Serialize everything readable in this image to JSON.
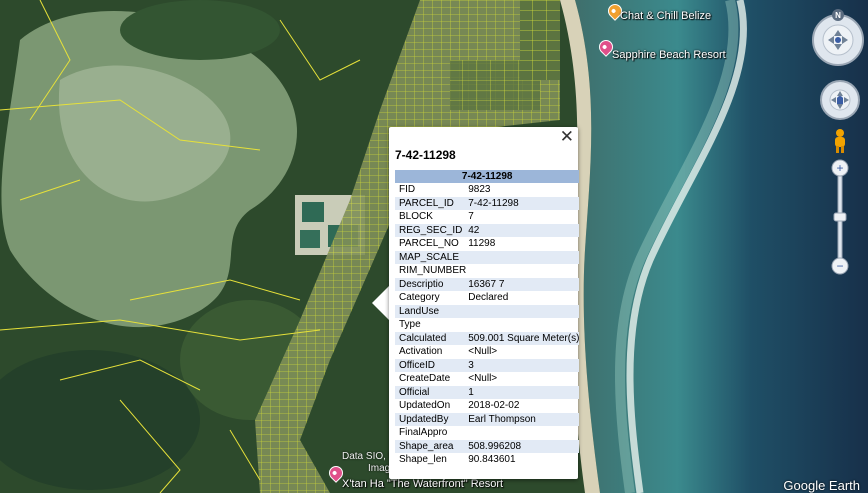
{
  "places": [
    {
      "name": "Chat & Chill Belize",
      "color": "#f0a030"
    },
    {
      "name": "Sapphire Beach Resort",
      "color": "#e0508a"
    },
    {
      "name": "X'tan Ha \"The Waterfront\" Resort",
      "color": "#e0508a"
    }
  ],
  "attribution": {
    "data": "Data SIO, N",
    "imagery": "Imag"
  },
  "watermark": "Google Earth",
  "controls": {
    "compass_north": "N",
    "zoom_in": "+",
    "zoom_out": "−"
  },
  "popup": {
    "close": "✕",
    "title": "7-42-11298",
    "table_header": "7-42-11298",
    "rows": [
      {
        "key": "FID",
        "value": "9823"
      },
      {
        "key": "PARCEL_ID",
        "value": "7-42-11298"
      },
      {
        "key": "BLOCK",
        "value": "7"
      },
      {
        "key": "REG_SEC_ID",
        "value": "42"
      },
      {
        "key": "PARCEL_NO",
        "value": "11298"
      },
      {
        "key": "MAP_SCALE",
        "value": ""
      },
      {
        "key": "RIM_NUMBER",
        "value": ""
      },
      {
        "key": "Descriptio",
        "value": "16367 7"
      },
      {
        "key": "Category",
        "value": "Declared"
      },
      {
        "key": "LandUse",
        "value": ""
      },
      {
        "key": "Type",
        "value": ""
      },
      {
        "key": "Calculated",
        "value": "509.001 Square Meter(s)"
      },
      {
        "key": "Activation",
        "value": "<Null>"
      },
      {
        "key": "OfficeID",
        "value": "3"
      },
      {
        "key": "CreateDate",
        "value": "<Null>"
      },
      {
        "key": "Official",
        "value": "1"
      },
      {
        "key": "UpdatedOn",
        "value": "2018-02-02"
      },
      {
        "key": "UpdatedBy",
        "value": "Earl Thompson"
      },
      {
        "key": "FinalAppro",
        "value": ""
      },
      {
        "key": "Shape_area",
        "value": "508.996208"
      },
      {
        "key": "Shape_len",
        "value": "90.843601"
      }
    ]
  }
}
